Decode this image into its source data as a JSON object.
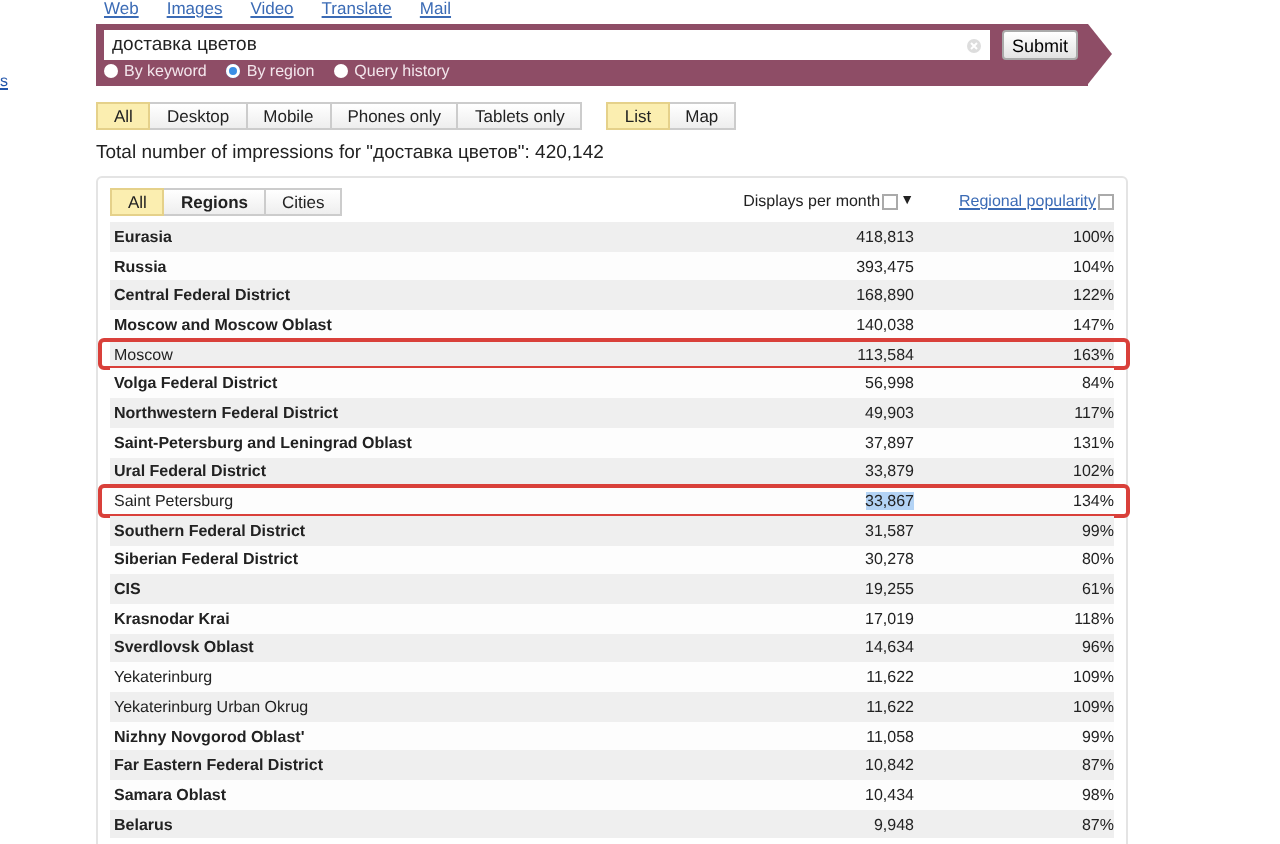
{
  "nav_links": [
    "Web",
    "Images",
    "Video",
    "Translate",
    "Mail"
  ],
  "left_link": "s",
  "search": {
    "value": "доставка цветов",
    "submit": "Submit"
  },
  "modes": [
    {
      "label": "By keyword",
      "selected": false
    },
    {
      "label": "By region",
      "selected": true
    },
    {
      "label": "Query history",
      "selected": false
    }
  ],
  "device_filters": [
    {
      "label": "All",
      "selected": true
    },
    {
      "label": "Desktop",
      "selected": false
    },
    {
      "label": "Mobile",
      "selected": false
    },
    {
      "label": "Phones only",
      "selected": false
    },
    {
      "label": "Tablets only",
      "selected": false
    }
  ],
  "view_tabs": [
    {
      "label": "List",
      "selected": true
    },
    {
      "label": "Map",
      "selected": false
    }
  ],
  "total": "Total number of impressions for \"доставка цветов\": 420,142",
  "table": {
    "tabs": [
      {
        "label": "All",
        "selected": true
      },
      {
        "label": "Regions",
        "selected": false
      },
      {
        "label": "Cities",
        "selected": false
      }
    ],
    "columns": {
      "displays": "Displays per month",
      "sort_mark": "▼",
      "popularity": "Regional popularity"
    },
    "rows": [
      {
        "name": "Eurasia",
        "displays": "418,813",
        "popularity": "100%",
        "bold": true,
        "highlighted": false,
        "displays_selected": false
      },
      {
        "name": "Russia",
        "displays": "393,475",
        "popularity": "104%",
        "bold": true,
        "highlighted": false,
        "displays_selected": false
      },
      {
        "name": "Central Federal District",
        "displays": "168,890",
        "popularity": "122%",
        "bold": true,
        "highlighted": false,
        "displays_selected": false
      },
      {
        "name": "Moscow and Moscow Oblast",
        "displays": "140,038",
        "popularity": "147%",
        "bold": true,
        "highlighted": false,
        "displays_selected": false
      },
      {
        "name": "Moscow",
        "displays": "113,584",
        "popularity": "163%",
        "bold": false,
        "highlighted": true,
        "displays_selected": false
      },
      {
        "name": "Volga Federal District",
        "displays": "56,998",
        "popularity": "84%",
        "bold": true,
        "highlighted": false,
        "displays_selected": false
      },
      {
        "name": "Northwestern Federal District",
        "displays": "49,903",
        "popularity": "117%",
        "bold": true,
        "highlighted": false,
        "displays_selected": false
      },
      {
        "name": "Saint-Petersburg and Leningrad Oblast",
        "displays": "37,897",
        "popularity": "131%",
        "bold": true,
        "highlighted": false,
        "displays_selected": false
      },
      {
        "name": "Ural Federal District",
        "displays": "33,879",
        "popularity": "102%",
        "bold": true,
        "highlighted": false,
        "displays_selected": false
      },
      {
        "name": "Saint Petersburg",
        "displays": "33,867",
        "popularity": "134%",
        "bold": false,
        "highlighted": true,
        "displays_selected": true
      },
      {
        "name": "Southern Federal District",
        "displays": "31,587",
        "popularity": "99%",
        "bold": true,
        "highlighted": false,
        "displays_selected": false
      },
      {
        "name": "Siberian Federal District",
        "displays": "30,278",
        "popularity": "80%",
        "bold": true,
        "highlighted": false,
        "displays_selected": false
      },
      {
        "name": "CIS",
        "displays": "19,255",
        "popularity": "61%",
        "bold": true,
        "highlighted": false,
        "displays_selected": false
      },
      {
        "name": "Krasnodar Krai",
        "displays": "17,019",
        "popularity": "118%",
        "bold": true,
        "highlighted": false,
        "displays_selected": false
      },
      {
        "name": "Sverdlovsk Oblast",
        "displays": "14,634",
        "popularity": "96%",
        "bold": true,
        "highlighted": false,
        "displays_selected": false
      },
      {
        "name": "Yekaterinburg",
        "displays": "11,622",
        "popularity": "109%",
        "bold": false,
        "highlighted": false,
        "displays_selected": false
      },
      {
        "name": "Yekaterinburg Urban Okrug",
        "displays": "11,622",
        "popularity": "109%",
        "bold": false,
        "highlighted": false,
        "displays_selected": false
      },
      {
        "name": "Nizhny Novgorod Oblast'",
        "displays": "11,058",
        "popularity": "99%",
        "bold": true,
        "highlighted": false,
        "displays_selected": false
      },
      {
        "name": "Far Eastern Federal District",
        "displays": "10,842",
        "popularity": "87%",
        "bold": true,
        "highlighted": false,
        "displays_selected": false
      },
      {
        "name": "Samara Oblast",
        "displays": "10,434",
        "popularity": "98%",
        "bold": true,
        "highlighted": false,
        "displays_selected": false
      },
      {
        "name": "Belarus",
        "displays": "9,948",
        "popularity": "87%",
        "bold": true,
        "highlighted": false,
        "displays_selected": false
      }
    ]
  }
}
